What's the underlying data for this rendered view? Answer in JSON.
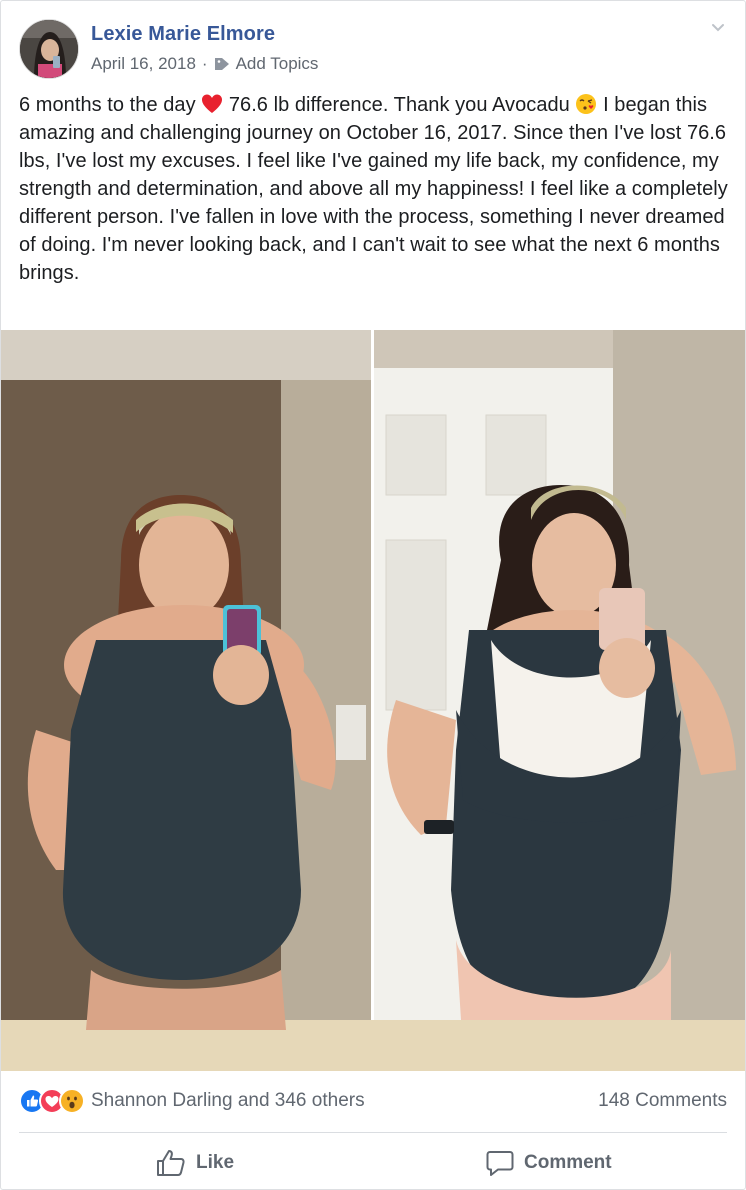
{
  "post": {
    "author": "Lexie Marie Elmore",
    "date": "April 16, 2018",
    "separator": "·",
    "add_topics": "Add Topics",
    "text_part1": "6 months to the day",
    "text_part2": "76.6 lb difference. Thank you Avocadu",
    "text_part3": "I began this amazing and challenging journey on October 16, 2017. Since then I've lost 76.6 lbs, I've lost my excuses. I feel like I've gained my life back, my confidence, my strength and determination, and above all my happiness! I feel like a completely different person. I've fallen in love with the process, something I never dreamed of doing. I'm never looking back, and I can't wait to see what the next 6 months brings."
  },
  "icons": {
    "avatar": "profile-photo",
    "tag": "tag-icon",
    "chevron": "chevron-down-icon",
    "heart": "red-heart-emoji",
    "kiss": "face-blowing-kiss-emoji",
    "reactions": [
      "like-reaction-icon",
      "love-reaction-icon",
      "wow-reaction-icon"
    ],
    "like": "thumbs-up-icon",
    "comment": "speech-bubble-icon"
  },
  "engagement": {
    "reactions_text": "Shannon Darling and 346 others",
    "comments_text": "148 Comments"
  },
  "actions": {
    "like_label": "Like",
    "comment_label": "Comment"
  },
  "colors": {
    "author_link": "#385898",
    "secondary_text": "#606770",
    "like_blue": "#1877f2",
    "love_red": "#f33e58",
    "wow_yellow": "#f7b125"
  }
}
